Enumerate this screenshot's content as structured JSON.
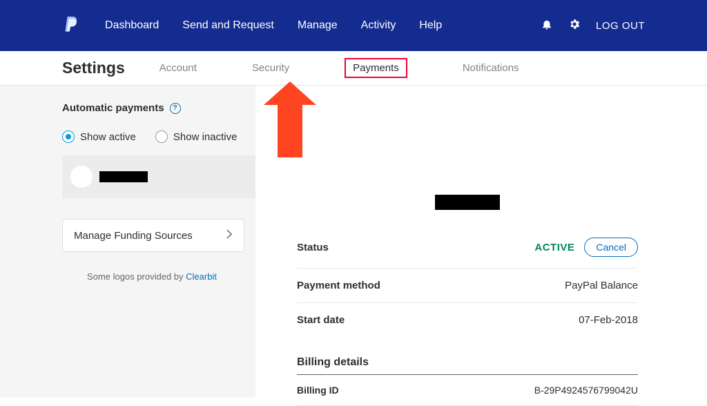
{
  "topnav": {
    "links": [
      "Dashboard",
      "Send and Request",
      "Manage",
      "Activity",
      "Help"
    ],
    "logout": "LOG OUT"
  },
  "subnav": {
    "title": "Settings",
    "tabs": [
      "Account",
      "Security",
      "Payments",
      "Notifications"
    ],
    "active_index": 2
  },
  "sidebar": {
    "heading": "Automatic payments",
    "radios": {
      "active": "Show active",
      "inactive": "Show inactive"
    },
    "manage_funding": "Manage Funding Sources",
    "attribution_prefix": "Some logos provided by ",
    "attribution_link": "Clearbit"
  },
  "detail": {
    "rows": {
      "status": {
        "label": "Status",
        "value": "ACTIVE",
        "cancel": "Cancel"
      },
      "payment_method": {
        "label": "Payment method",
        "value": "PayPal Balance"
      },
      "start_date": {
        "label": "Start date",
        "value": "07-Feb-2018"
      }
    },
    "billing": {
      "title": "Billing details",
      "billing_id": {
        "label": "Billing ID",
        "value": "B-29P4924576799042U"
      }
    }
  }
}
